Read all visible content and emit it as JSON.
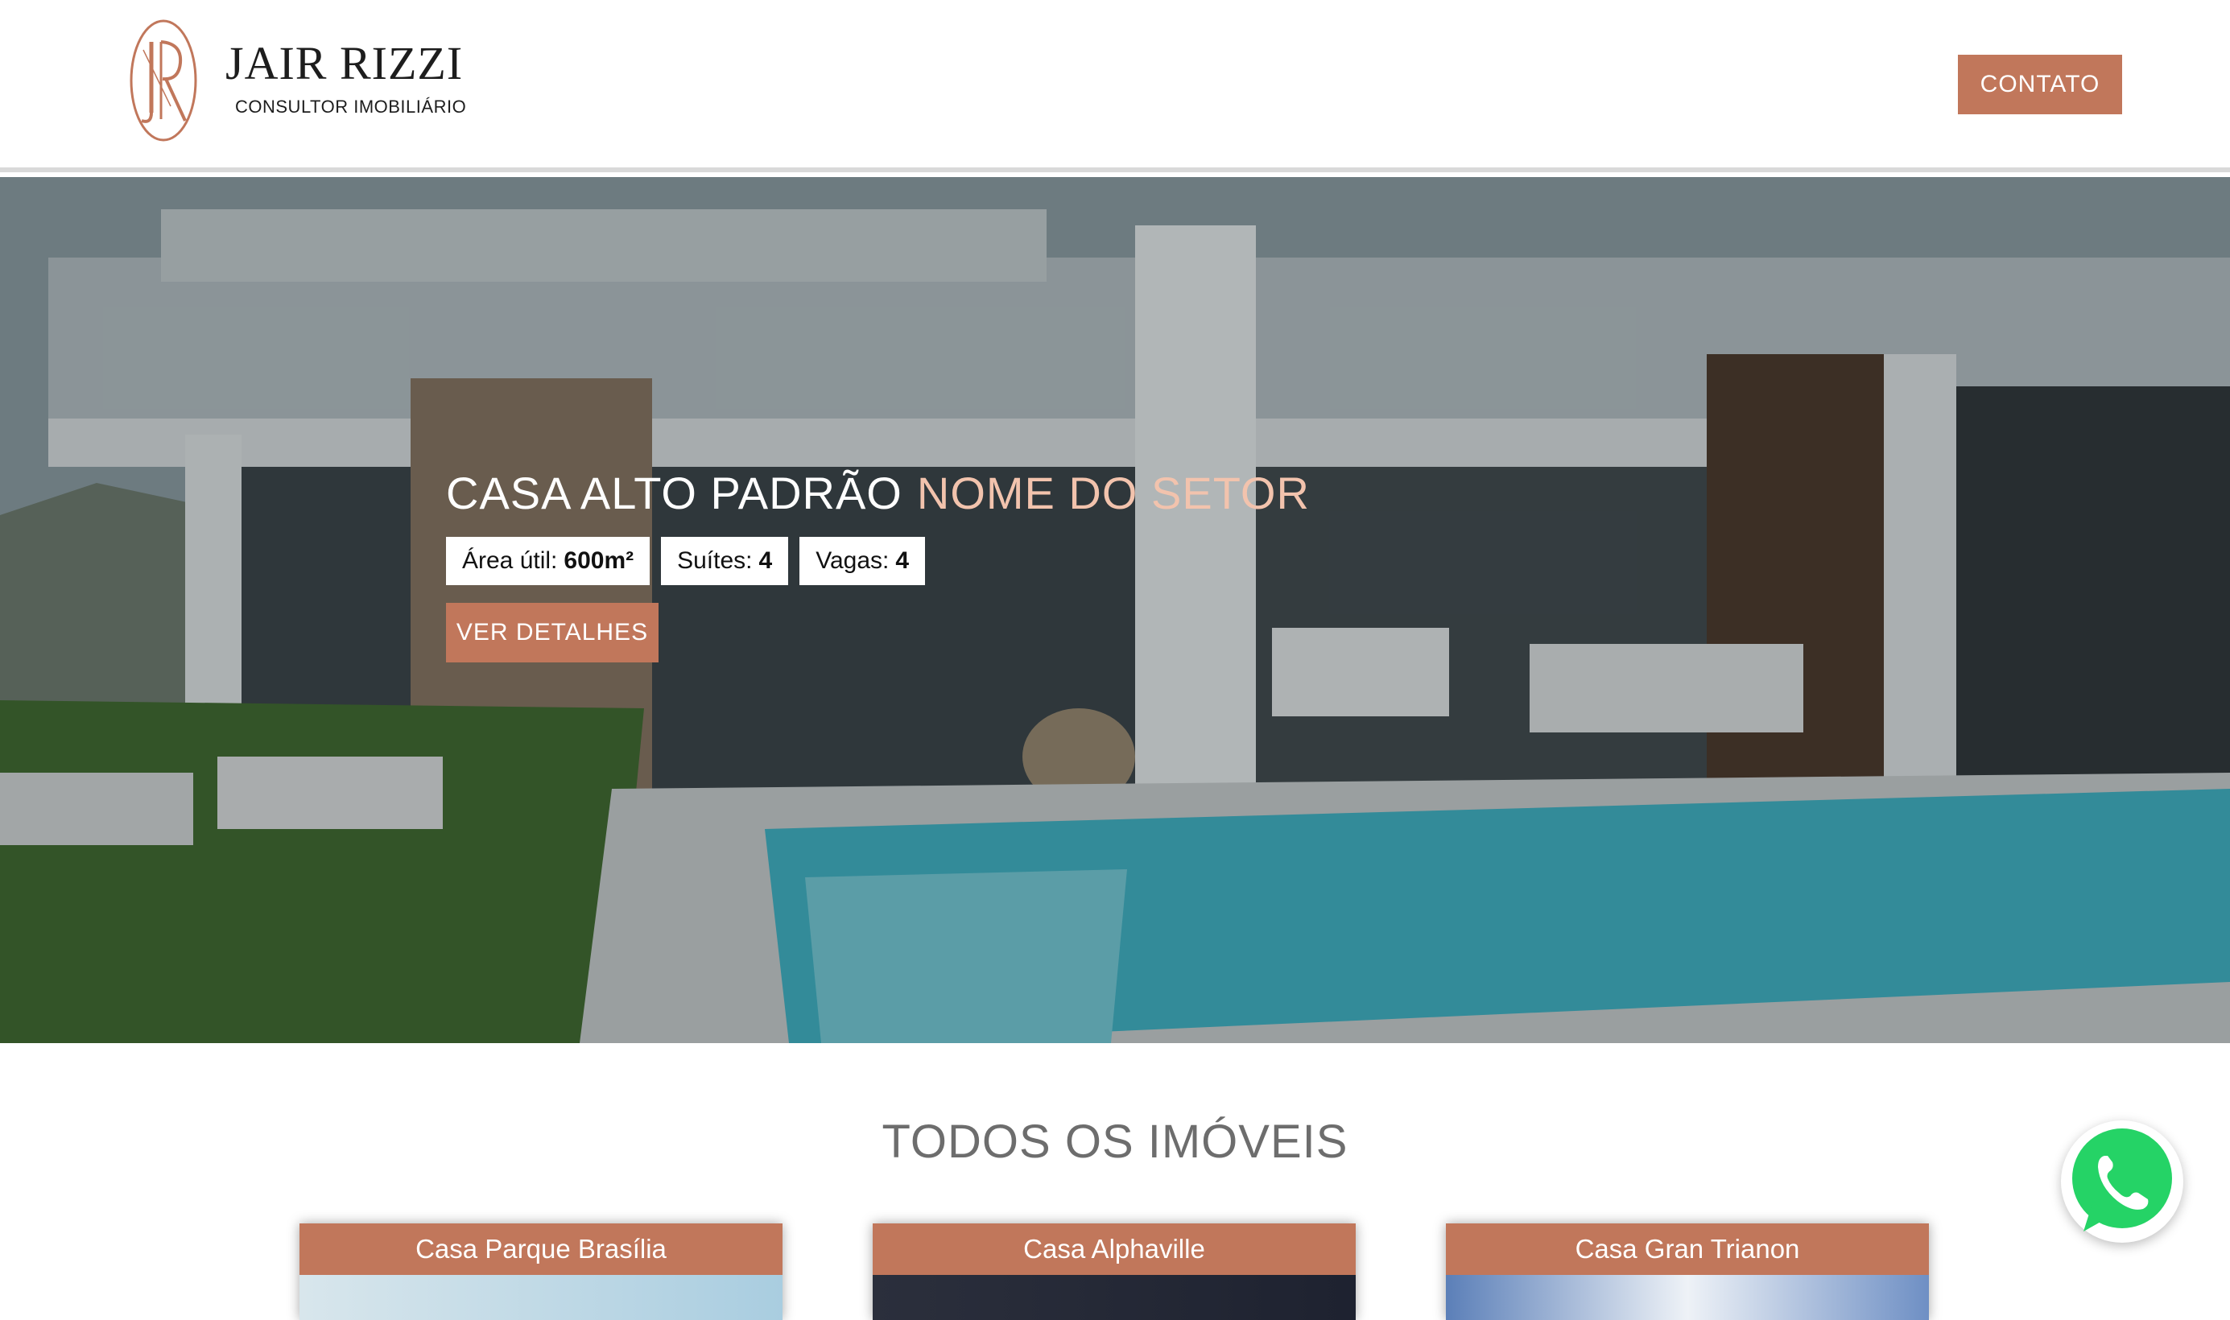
{
  "header": {
    "brand_name": "JAIR RIZZI",
    "brand_sub": "CONSULTOR IMOBILIÁRIO",
    "contact_label": "CONTATO"
  },
  "hero": {
    "title": "CASA ALTO PADRÃO",
    "sector": "NOME DO SETOR",
    "features": [
      {
        "label": "Área útil:",
        "value": "600m²"
      },
      {
        "label": "Suítes:",
        "value": "4"
      },
      {
        "label": "Vagas:",
        "value": "4"
      }
    ],
    "details_label": "VER DETALHES"
  },
  "listing": {
    "title": "TODOS OS IMÓVEIS",
    "cards": [
      {
        "title": "Casa Parque Brasília"
      },
      {
        "title": "Casa Alphaville"
      },
      {
        "title": "Casa Gran Trianon"
      }
    ]
  },
  "colors": {
    "accent": "#c1775b",
    "sector": "#f2c3ad",
    "whatsapp": "#25d366"
  },
  "icons": {
    "logo": "jr-monogram-icon",
    "whatsapp": "whatsapp-icon"
  }
}
